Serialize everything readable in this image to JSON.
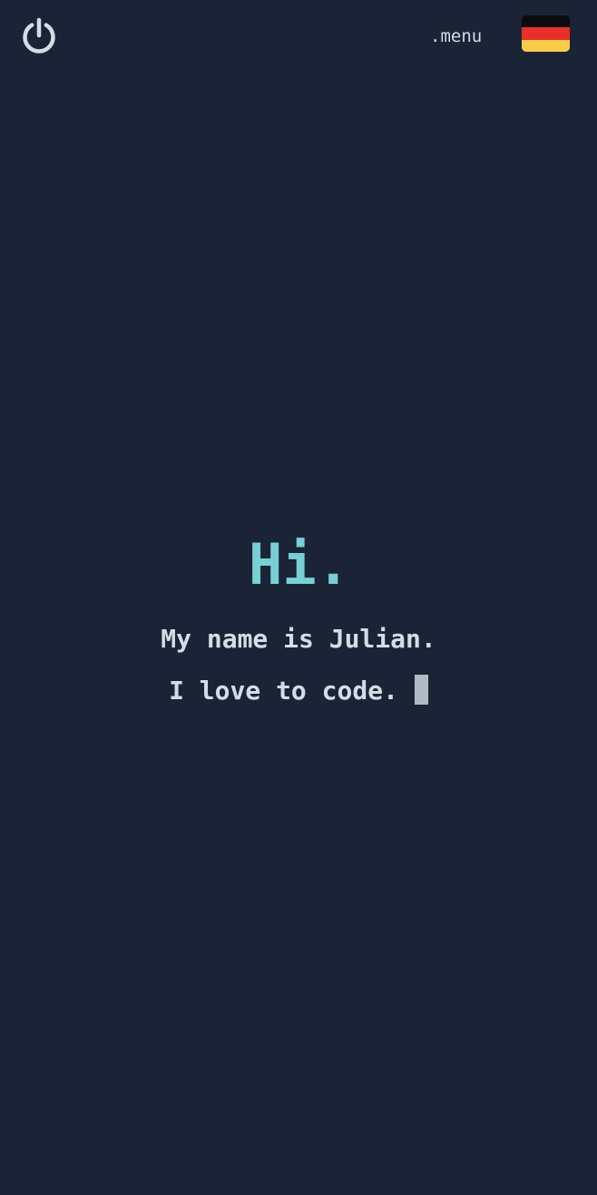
{
  "header": {
    "power_icon": "power-icon",
    "menu_label": ".menu",
    "language_flag": "germany-flag-icon"
  },
  "hero": {
    "title": "Hi.",
    "line1": "My name is Julian.",
    "line2": "I love to code."
  },
  "colors": {
    "background": "#1a2436",
    "accent": "#76d0d4",
    "text": "#d4dde6",
    "cursor": "#aebbc6",
    "flag_black": "#0b0b0b",
    "flag_red": "#e8302a",
    "flag_gold": "#f9cc48"
  }
}
